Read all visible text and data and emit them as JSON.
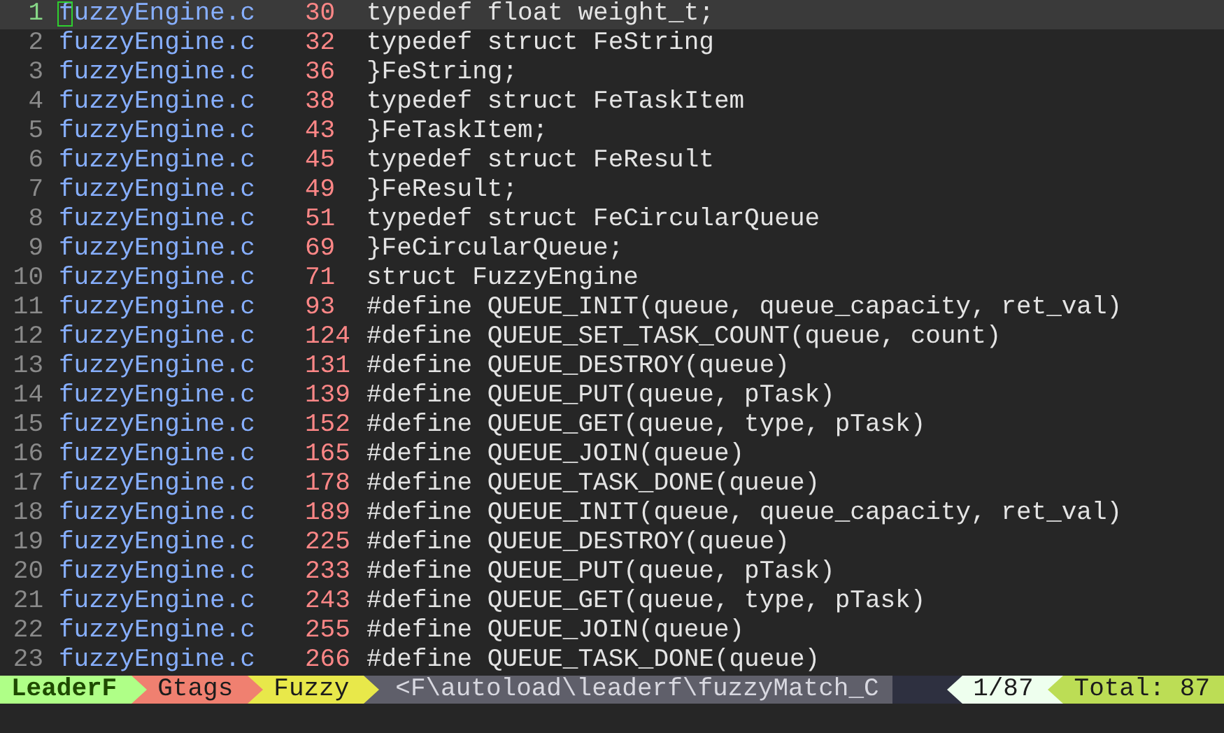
{
  "results": [
    {
      "index": "1",
      "file": "fuzzyEngine.c",
      "line": "30",
      "text": "typedef float weight_t;",
      "selected": true
    },
    {
      "index": "2",
      "file": "fuzzyEngine.c",
      "line": "32",
      "text": "typedef struct FeString",
      "selected": false
    },
    {
      "index": "3",
      "file": "fuzzyEngine.c",
      "line": "36",
      "text": "}FeString;",
      "selected": false
    },
    {
      "index": "4",
      "file": "fuzzyEngine.c",
      "line": "38",
      "text": "typedef struct FeTaskItem",
      "selected": false
    },
    {
      "index": "5",
      "file": "fuzzyEngine.c",
      "line": "43",
      "text": "}FeTaskItem;",
      "selected": false
    },
    {
      "index": "6",
      "file": "fuzzyEngine.c",
      "line": "45",
      "text": "typedef struct FeResult",
      "selected": false
    },
    {
      "index": "7",
      "file": "fuzzyEngine.c",
      "line": "49",
      "text": "}FeResult;",
      "selected": false
    },
    {
      "index": "8",
      "file": "fuzzyEngine.c",
      "line": "51",
      "text": "typedef struct FeCircularQueue",
      "selected": false
    },
    {
      "index": "9",
      "file": "fuzzyEngine.c",
      "line": "69",
      "text": "}FeCircularQueue;",
      "selected": false
    },
    {
      "index": "10",
      "file": "fuzzyEngine.c",
      "line": "71",
      "text": "struct FuzzyEngine",
      "selected": false
    },
    {
      "index": "11",
      "file": "fuzzyEngine.c",
      "line": "93",
      "text": "#define QUEUE_INIT(queue, queue_capacity, ret_val)",
      "selected": false
    },
    {
      "index": "12",
      "file": "fuzzyEngine.c",
      "line": "124",
      "text": "#define QUEUE_SET_TASK_COUNT(queue, count)",
      "selected": false
    },
    {
      "index": "13",
      "file": "fuzzyEngine.c",
      "line": "131",
      "text": "#define QUEUE_DESTROY(queue)",
      "selected": false
    },
    {
      "index": "14",
      "file": "fuzzyEngine.c",
      "line": "139",
      "text": "#define QUEUE_PUT(queue, pTask)",
      "selected": false
    },
    {
      "index": "15",
      "file": "fuzzyEngine.c",
      "line": "152",
      "text": "#define QUEUE_GET(queue, type, pTask)",
      "selected": false
    },
    {
      "index": "16",
      "file": "fuzzyEngine.c",
      "line": "165",
      "text": "#define QUEUE_JOIN(queue)",
      "selected": false
    },
    {
      "index": "17",
      "file": "fuzzyEngine.c",
      "line": "178",
      "text": "#define QUEUE_TASK_DONE(queue)",
      "selected": false
    },
    {
      "index": "18",
      "file": "fuzzyEngine.c",
      "line": "189",
      "text": "#define QUEUE_INIT(queue, queue_capacity, ret_val)",
      "selected": false
    },
    {
      "index": "19",
      "file": "fuzzyEngine.c",
      "line": "225",
      "text": "#define QUEUE_DESTROY(queue)",
      "selected": false
    },
    {
      "index": "20",
      "file": "fuzzyEngine.c",
      "line": "233",
      "text": "#define QUEUE_PUT(queue, pTask)",
      "selected": false
    },
    {
      "index": "21",
      "file": "fuzzyEngine.c",
      "line": "243",
      "text": "#define QUEUE_GET(queue, type, pTask)",
      "selected": false
    },
    {
      "index": "22",
      "file": "fuzzyEngine.c",
      "line": "255",
      "text": "#define QUEUE_JOIN(queue)",
      "selected": false
    },
    {
      "index": "23",
      "file": "fuzzyEngine.c",
      "line": "266",
      "text": "#define QUEUE_TASK_DONE(queue)",
      "selected": false
    }
  ],
  "status_bar": {
    "left": [
      {
        "text": "LeaderF",
        "color": "#afff87",
        "bold": true
      },
      {
        "text": "Gtags",
        "color": "#f08070",
        "bold": false
      },
      {
        "text": "Fuzzy",
        "color": "#e8e84a",
        "bold": false
      },
      {
        "text": "<F\\autoload\\leaderf\\fuzzyMatch_C",
        "color": "#5f5f6a",
        "bold": false
      }
    ],
    "right": [
      {
        "text": "1/87",
        "color": "#eeffee",
        "bold": false
      },
      {
        "text": "Total: 87",
        "color": "#bcdd55",
        "bold": false
      }
    ]
  }
}
